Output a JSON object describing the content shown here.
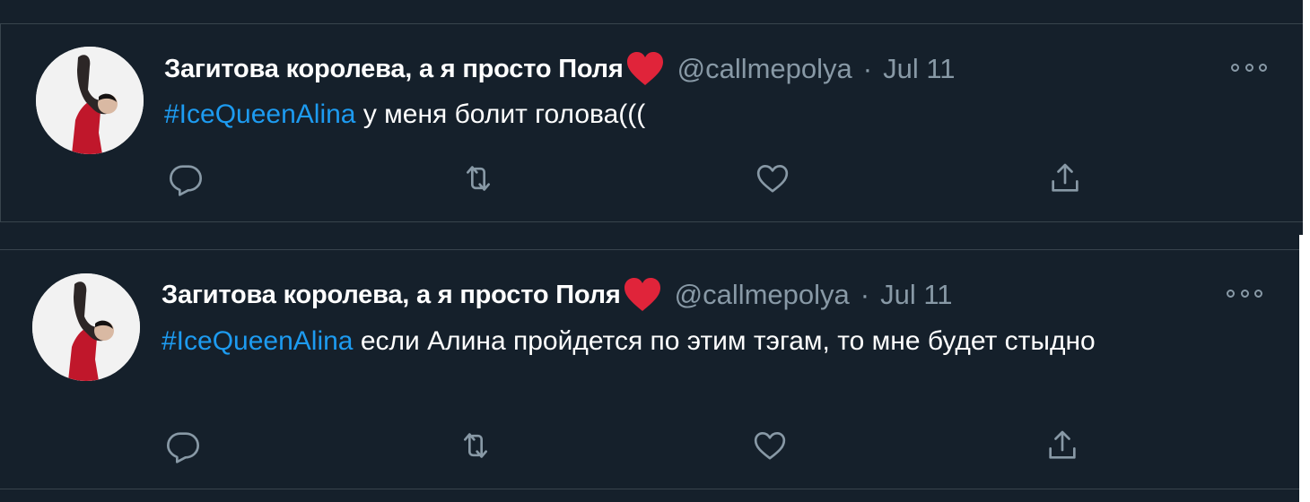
{
  "colors": {
    "background": "#15202b",
    "border": "#38444d",
    "text_primary": "#ffffff",
    "text_secondary": "#8899a6",
    "hashtag": "#1d9bf0",
    "heart": "#e0243a"
  },
  "tweets": [
    {
      "author_name": "Загитова королева, а я просто Поля",
      "name_emoji": "red-heart-icon",
      "handle": "@callmepolya",
      "separator": "·",
      "date": "Jul 11",
      "hashtag": "#IceQueenAlina",
      "text": " у меня болит голова(((",
      "actions": [
        "reply-icon",
        "retweet-icon",
        "like-icon",
        "share-icon"
      ]
    },
    {
      "author_name": "Загитова королева, а я просто Поля",
      "name_emoji": "red-heart-icon",
      "handle": "@callmepolya",
      "separator": "·",
      "date": "Jul 11",
      "hashtag": "#IceQueenAlina",
      "text": " если Алина пройдется по этим тэгам, то мне будет стыдно",
      "actions": [
        "reply-icon",
        "retweet-icon",
        "like-icon",
        "share-icon"
      ]
    }
  ]
}
